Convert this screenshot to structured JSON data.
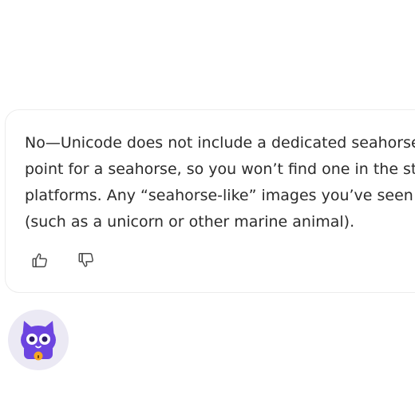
{
  "message": {
    "lines": [
      "No—Unicode does not include a dedicated seahorse emoji. There is no code",
      "point for a seahorse, so you won’t find one in the standard set across",
      "platforms. Any “seahorse-like” images you’ve seen are likely a different emoji",
      "(such as a unicorn or other marine animal)."
    ]
  },
  "actions": {
    "like_icon": "thumbs-up-icon",
    "dislike_icon": "thumbs-down-icon"
  },
  "avatar": {
    "icon": "cat-mascot-icon",
    "colors": {
      "background": "#ebe9f4",
      "body": "#6c44e0",
      "bell": "#f5a623"
    }
  }
}
